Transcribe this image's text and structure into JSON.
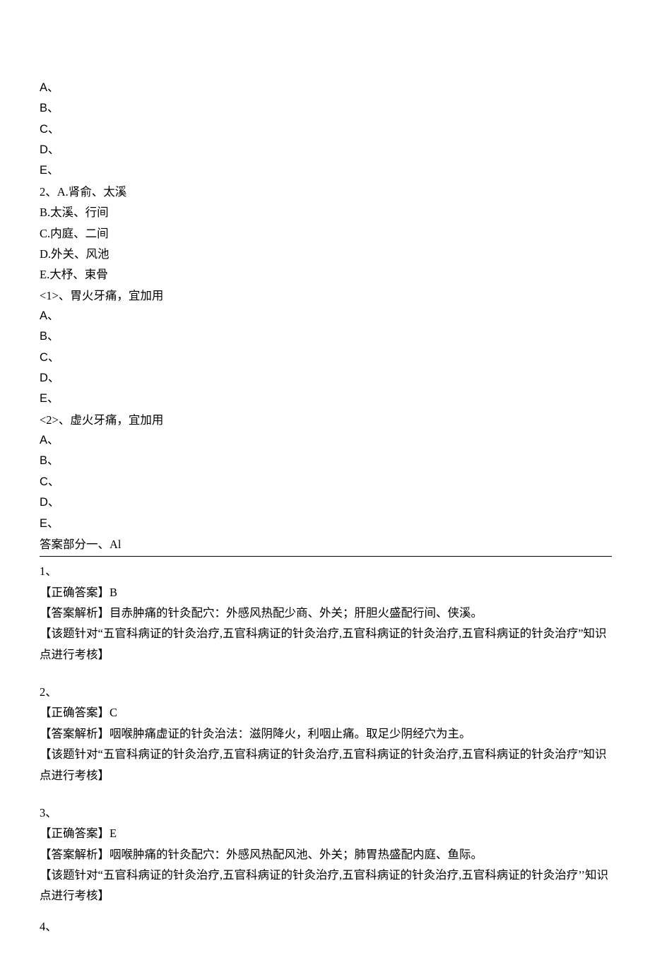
{
  "top_block": {
    "options": [
      "A、",
      "B、",
      "C、",
      "D、",
      "E、"
    ]
  },
  "q2": {
    "header": "2、A.肾俞、太溪",
    "choices_rest": [
      "B.太溪、行间",
      "C.内庭、二间",
      "D.外关、风池",
      "E.大杼、束骨"
    ],
    "sub1": {
      "prompt": "<1>、胃火牙痛，宜加用",
      "options": [
        "A、",
        "B、",
        "C、",
        "D、",
        "E、"
      ]
    },
    "sub2": {
      "prompt": "<2>、虚火牙痛，宜加用",
      "options": [
        "A、",
        "B、",
        "C、",
        "D、",
        "E、"
      ]
    }
  },
  "answers_header": "答案部分一、Al",
  "ans1": {
    "num": "1、",
    "correct": "【正确答案】B",
    "explain": "【答案解析】目赤肿痛的针灸配穴：外感风热配少商、外关；肝胆火盛配行间、侠溪。",
    "topic": "【该题针对“五官科病证的针灸治疗,五官科病证的针灸治疗,五官科病证的针灸治疗,五官科病证的针灸治疗”知识点进行考核】"
  },
  "ans2": {
    "num": "2、",
    "correct": "【正确答案】C",
    "explain": "【答案解析】咽喉肿痛虚证的针灸治法：滋阴降火，利咽止痛。取足少阴经穴为主。",
    "topic": "【该题针对“五官科病证的针灸治疗,五官科病证的针灸治疗,五官科病证的针灸治疗,五官科病证的针灸治疗”知识点进行考核】"
  },
  "ans3": {
    "num": "3、",
    "correct": "【正确答案】E",
    "explain": "【答案解析】咽喉肿痛的针灸配穴：外感风热配风池、外关；肺胃热盛配内庭、鱼际。",
    "topic": "【该题针对“五官科病证的针灸治疗,五官科病证的针灸治疗,五官科病证的针灸治疗,五官科病证的针灸治疗’’知识点进行考核】"
  },
  "ans4": {
    "num": "4、"
  }
}
